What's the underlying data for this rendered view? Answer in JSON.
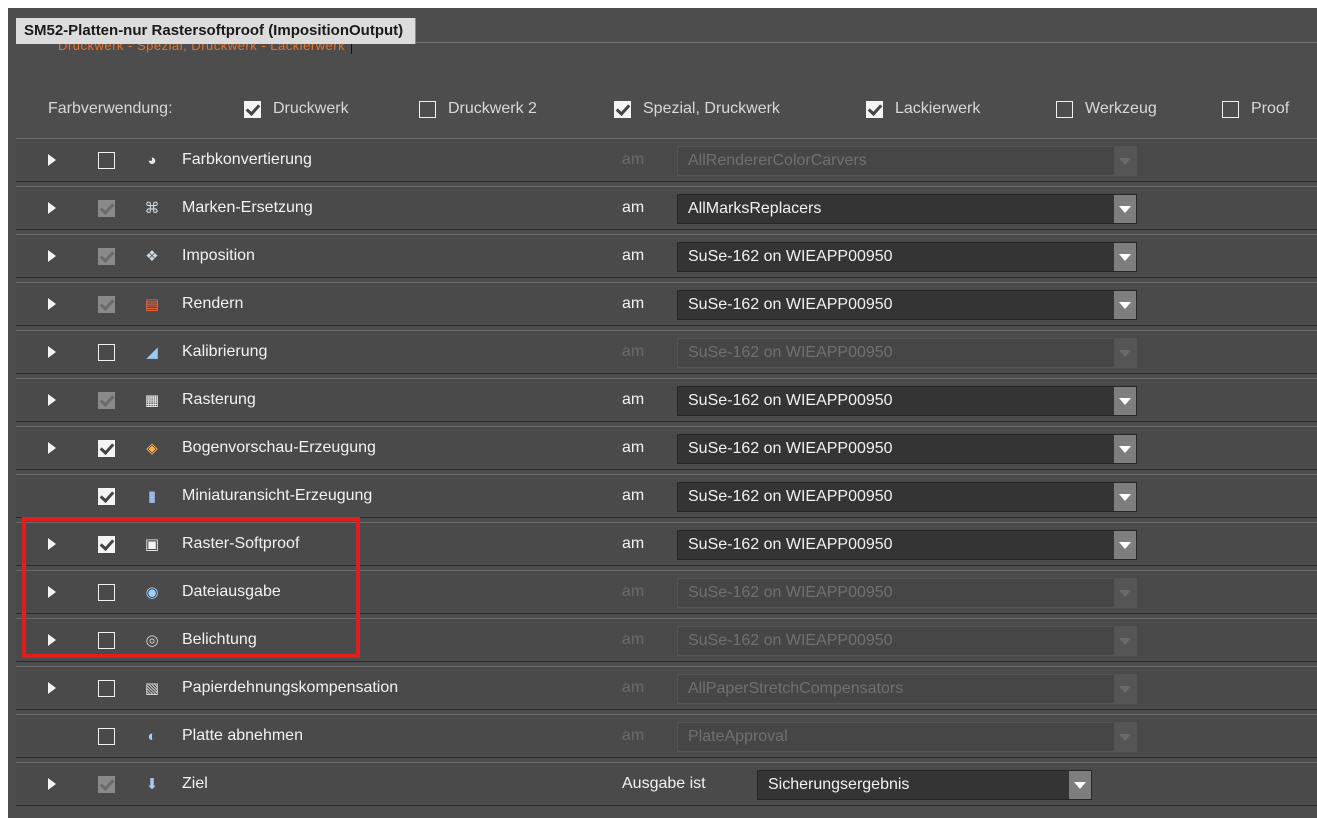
{
  "window": {
    "title": "SM52-Platten-nur Rastersoftproof (ImpositionOutput)"
  },
  "background_tab": {
    "text": "Druckwerk - Spezial, Druckwerk - Lackierwerk"
  },
  "farbverwendung": {
    "label": "Farbverwendung:",
    "options": [
      {
        "label": "Druckwerk",
        "checked": true
      },
      {
        "label": "Druckwerk 2",
        "checked": false
      },
      {
        "label": "Spezial, Druckwerk",
        "checked": true
      },
      {
        "label": "Lackierwerk",
        "checked": true
      },
      {
        "label": "Werkzeug",
        "checked": false
      },
      {
        "label": "Proof",
        "checked": false
      }
    ]
  },
  "processes": [
    {
      "label": "Farbkonvertierung",
      "icon": "color-convert-icon",
      "expandable": true,
      "checked": false,
      "enabled": false,
      "am": "am",
      "value": "AllRendererColorCarvers"
    },
    {
      "label": "Marken-Ersetzung",
      "icon": "marks-replace-icon",
      "expandable": true,
      "checked": true,
      "enabled": true,
      "am": "am",
      "value": "AllMarksReplacers"
    },
    {
      "label": "Imposition",
      "icon": "imposition-icon",
      "expandable": true,
      "checked": true,
      "enabled": true,
      "am": "am",
      "value": "SuSe-162 on WIEAPP00950"
    },
    {
      "label": "Rendern",
      "icon": "render-icon",
      "expandable": true,
      "checked": true,
      "enabled": true,
      "am": "am",
      "value": "SuSe-162 on WIEAPP00950"
    },
    {
      "label": "Kalibrierung",
      "icon": "calibration-icon",
      "expandable": true,
      "checked": false,
      "enabled": false,
      "am": "am",
      "value": "SuSe-162 on WIEAPP00950"
    },
    {
      "label": "Rasterung",
      "icon": "screening-icon",
      "expandable": true,
      "checked": true,
      "enabled": true,
      "am": "am",
      "value": "SuSe-162 on WIEAPP00950"
    },
    {
      "label": "Bogenvorschau-Erzeugung",
      "icon": "sheet-preview-icon",
      "expandable": true,
      "checked": true,
      "enabled": true,
      "am": "am",
      "value": "SuSe-162 on WIEAPP00950"
    },
    {
      "label": "Miniaturansicht-Erzeugung",
      "icon": "thumbnail-icon",
      "expandable": false,
      "checked": true,
      "enabled": true,
      "am": "am",
      "value": "SuSe-162 on WIEAPP00950"
    },
    {
      "label": "Raster-Softproof",
      "icon": "softproof-icon",
      "expandable": true,
      "checked": true,
      "enabled": true,
      "am": "am",
      "value": "SuSe-162 on WIEAPP00950"
    },
    {
      "label": "Dateiausgabe",
      "icon": "file-output-icon",
      "expandable": true,
      "checked": false,
      "enabled": false,
      "am": "am",
      "value": "SuSe-162 on WIEAPP00950"
    },
    {
      "label": "Belichtung",
      "icon": "exposure-icon",
      "expandable": true,
      "checked": false,
      "enabled": false,
      "am": "am",
      "value": "SuSe-162 on WIEAPP00950"
    },
    {
      "label": "Papierdehnungskompensation",
      "icon": "paper-stretch-icon",
      "expandable": true,
      "checked": false,
      "enabled": false,
      "am": "am",
      "value": "AllPaperStretchCompensators"
    },
    {
      "label": "Platte abnehmen",
      "icon": "plate-approval-icon",
      "expandable": false,
      "checked": false,
      "enabled": false,
      "am": "am",
      "value": "PlateApproval"
    }
  ],
  "ziel": {
    "label": "Ziel",
    "icon": "arrow-down-icon",
    "checked": true,
    "output_label": "Ausgabe ist",
    "value": "Sicherungsergebnis"
  },
  "colors": {
    "highlight": "#e11e1e",
    "background_tab_text": "#e8722a"
  }
}
